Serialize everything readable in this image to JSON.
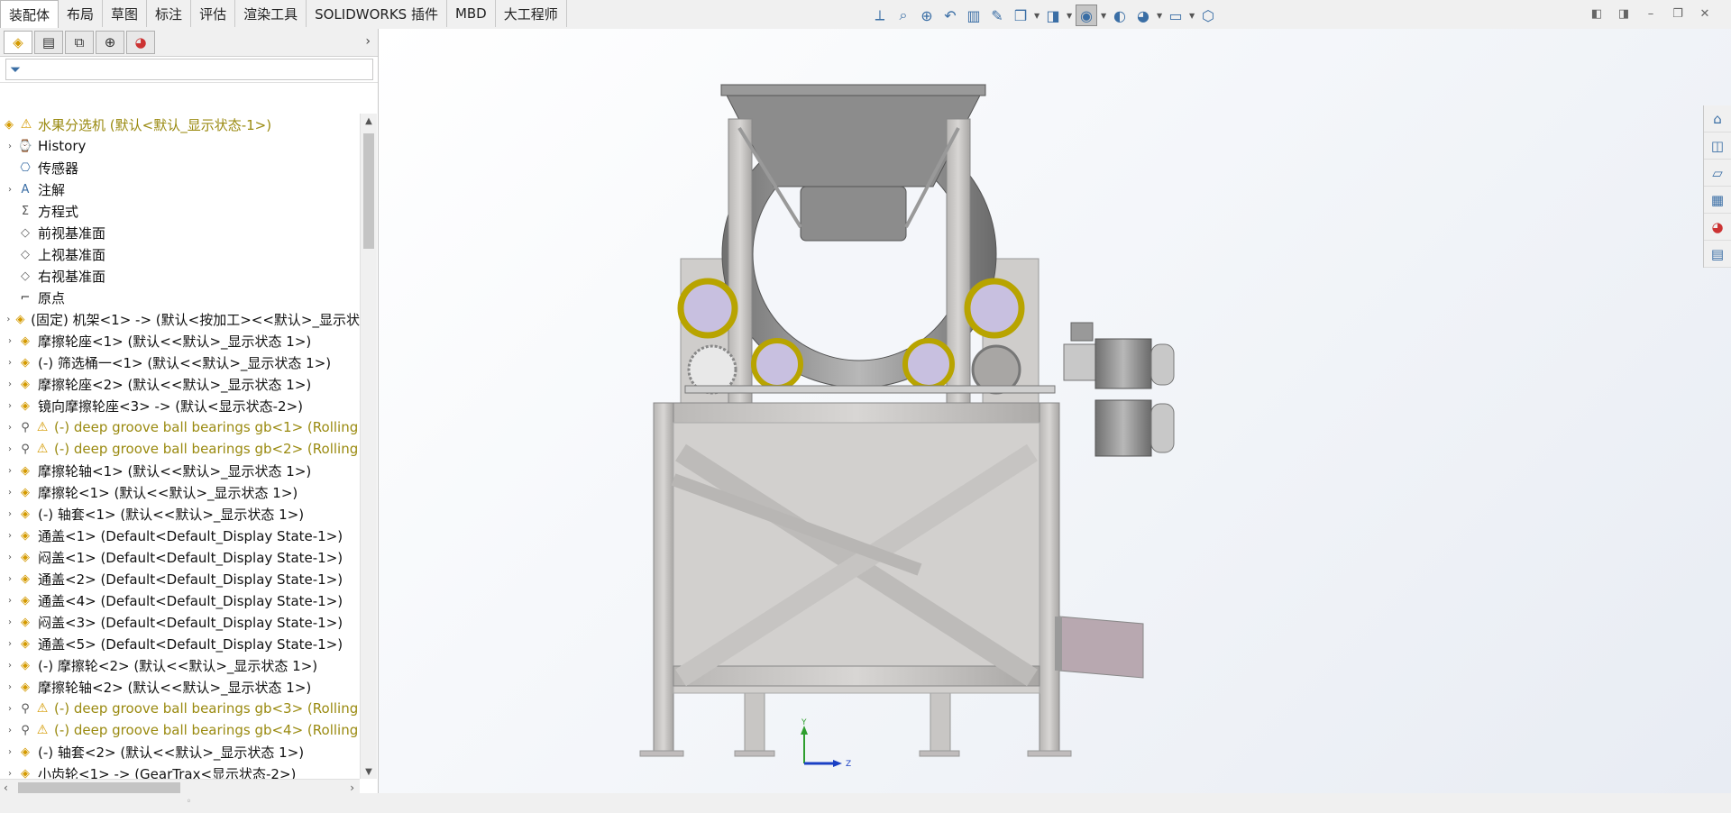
{
  "tabs": [
    "装配体",
    "布局",
    "草图",
    "标注",
    "评估",
    "渲染工具",
    "SOLIDWORKS 插件",
    "MBD",
    "大工程师"
  ],
  "active_tab": 0,
  "toolbar_icons": [
    "view-orientation-icon",
    "zoom-to-fit-icon",
    "zoom-area-icon",
    "previous-view-icon",
    "section-view-icon",
    "dynamic-annotation-icon",
    "view-orientation-menu-icon",
    "display-style-icon",
    "hide-show-icon",
    "edit-appearance-icon",
    "apply-scene-icon",
    "view-settings-icon",
    "display-monitor-icon",
    "3d-box-icon"
  ],
  "feature_tree": {
    "filter_placeholder": "",
    "root": {
      "label": "水果分选机  (默认<默认_显示状态-1>)",
      "warning": true
    },
    "items": [
      {
        "label": "History",
        "icon": "history",
        "expand": true,
        "warning": false,
        "yellow": false
      },
      {
        "label": "传感器",
        "icon": "sensor",
        "expand": false,
        "warning": false,
        "yellow": false
      },
      {
        "label": "注解",
        "icon": "annotation",
        "expand": true,
        "warning": false,
        "yellow": false
      },
      {
        "label": "方程式",
        "icon": "equation",
        "expand": false,
        "warning": false,
        "yellow": false
      },
      {
        "label": "前视基准面",
        "icon": "plane",
        "expand": false,
        "warning": false,
        "yellow": false
      },
      {
        "label": "上视基准面",
        "icon": "plane",
        "expand": false,
        "warning": false,
        "yellow": false
      },
      {
        "label": "右视基准面",
        "icon": "plane",
        "expand": false,
        "warning": false,
        "yellow": false
      },
      {
        "label": "原点",
        "icon": "origin",
        "expand": false,
        "warning": false,
        "yellow": false
      },
      {
        "label": "(固定) 机架<1> -> (默认<按加工><<默认>_显示状",
        "icon": "part",
        "expand": true,
        "warning": false,
        "yellow": false
      },
      {
        "label": "摩擦轮座<1> (默认<<默认>_显示状态 1>)",
        "icon": "part",
        "expand": true,
        "warning": false,
        "yellow": false
      },
      {
        "label": "(-) 筛选桶一<1> (默认<<默认>_显示状态 1>)",
        "icon": "part",
        "expand": true,
        "warning": false,
        "yellow": false
      },
      {
        "label": "摩擦轮座<2> (默认<<默认>_显示状态 1>)",
        "icon": "part",
        "expand": true,
        "warning": false,
        "yellow": false
      },
      {
        "label": "镜向摩擦轮座<3> -> (默认<显示状态-2>)",
        "icon": "part",
        "expand": true,
        "warning": false,
        "yellow": false
      },
      {
        "label": "(-) deep groove ball bearings gb<1> (Rolling",
        "icon": "bearing",
        "expand": true,
        "warning": true,
        "yellow": true
      },
      {
        "label": "(-) deep groove ball bearings gb<2> (Rolling",
        "icon": "bearing",
        "expand": true,
        "warning": true,
        "yellow": true
      },
      {
        "label": "摩擦轮轴<1> (默认<<默认>_显示状态 1>)",
        "icon": "part",
        "expand": true,
        "warning": false,
        "yellow": false
      },
      {
        "label": "摩擦轮<1> (默认<<默认>_显示状态 1>)",
        "icon": "part",
        "expand": true,
        "warning": false,
        "yellow": false
      },
      {
        "label": "(-) 轴套<1> (默认<<默认>_显示状态 1>)",
        "icon": "part",
        "expand": true,
        "warning": false,
        "yellow": false
      },
      {
        "label": "通盖<1> (Default<Default_Display State-1>)",
        "icon": "part",
        "expand": true,
        "warning": false,
        "yellow": false
      },
      {
        "label": "闷盖<1> (Default<Default_Display State-1>)",
        "icon": "part",
        "expand": true,
        "warning": false,
        "yellow": false
      },
      {
        "label": "通盖<2> (Default<Default_Display State-1>)",
        "icon": "part",
        "expand": true,
        "warning": false,
        "yellow": false
      },
      {
        "label": "通盖<4> (Default<Default_Display State-1>)",
        "icon": "part",
        "expand": true,
        "warning": false,
        "yellow": false
      },
      {
        "label": "闷盖<3> (Default<Default_Display State-1>)",
        "icon": "part",
        "expand": true,
        "warning": false,
        "yellow": false
      },
      {
        "label": "通盖<5> (Default<Default_Display State-1>)",
        "icon": "part",
        "expand": true,
        "warning": false,
        "yellow": false
      },
      {
        "label": "(-) 摩擦轮<2> (默认<<默认>_显示状态 1>)",
        "icon": "part",
        "expand": true,
        "warning": false,
        "yellow": false
      },
      {
        "label": "摩擦轮轴<2> (默认<<默认>_显示状态 1>)",
        "icon": "part",
        "expand": true,
        "warning": false,
        "yellow": false
      },
      {
        "label": "(-) deep groove ball bearings gb<3> (Rolling",
        "icon": "bearing",
        "expand": true,
        "warning": true,
        "yellow": true
      },
      {
        "label": "(-) deep groove ball bearings gb<4> (Rolling",
        "icon": "bearing",
        "expand": true,
        "warning": true,
        "yellow": true
      },
      {
        "label": "(-) 轴套<2> (默认<<默认>_显示状态 1>)",
        "icon": "part",
        "expand": true,
        "warning": false,
        "yellow": false
      },
      {
        "label": "小齿轮<1> -> (GearTrax<显示状态-2>)",
        "icon": "part",
        "expand": true,
        "warning": false,
        "yellow": false
      }
    ]
  },
  "triad": {
    "y_label": "Y",
    "z_label": "Z"
  },
  "colors": {
    "yellow_text": "#9a8a10",
    "warning": "#d49a00",
    "accent": "#3a6ea5",
    "axis_y": "#2e9e2e",
    "axis_z": "#1a3fc4"
  }
}
